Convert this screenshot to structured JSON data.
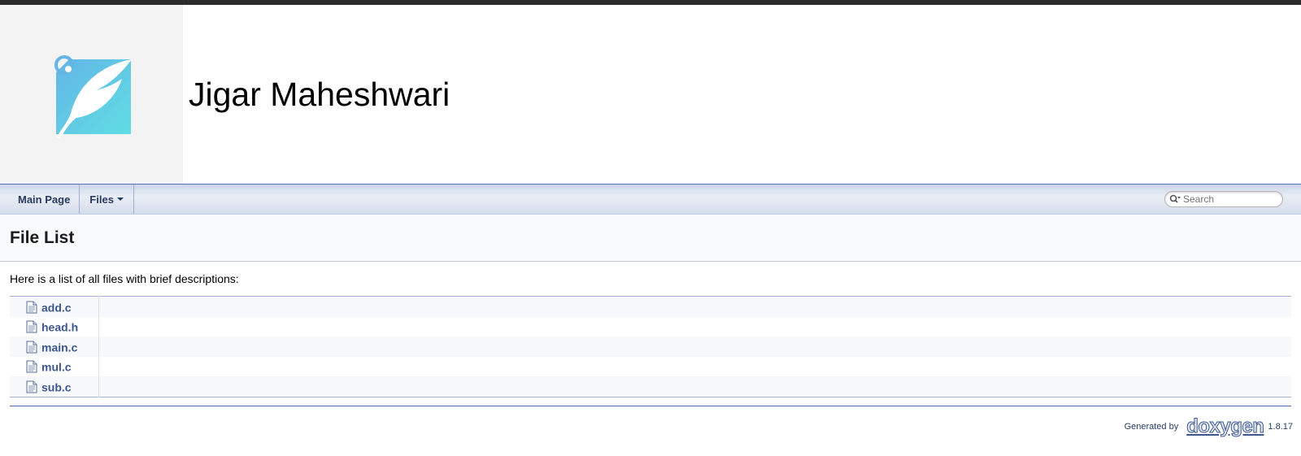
{
  "header": {
    "project_name": "Jigar Maheshwari",
    "logo_icon": "feather-quill-icon",
    "logo_colors": [
      "#64b5e6",
      "#5fdde3"
    ]
  },
  "navbar": {
    "items": [
      {
        "label": "Main Page"
      },
      {
        "label": "Files"
      }
    ],
    "search_placeholder": "Search"
  },
  "page": {
    "title": "File List",
    "intro": "Here is a list of all files with brief descriptions:",
    "files": [
      {
        "name": "add.c",
        "description": ""
      },
      {
        "name": "head.h",
        "description": ""
      },
      {
        "name": "main.c",
        "description": ""
      },
      {
        "name": "mul.c",
        "description": ""
      },
      {
        "name": "sub.c",
        "description": ""
      }
    ]
  },
  "footer": {
    "generated_by": "Generated by",
    "tool": "doxygen",
    "version": "1.8.17"
  }
}
